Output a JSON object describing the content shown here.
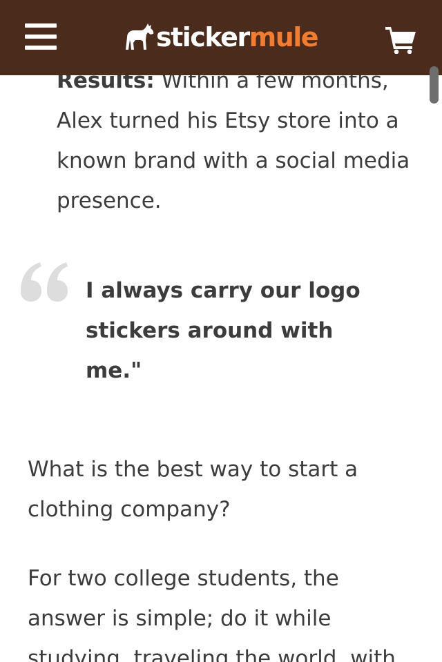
{
  "header": {
    "logo_word1": "sticker",
    "logo_word2": "mule",
    "colors": {
      "background": "#4a2b1c",
      "logo_primary": "#ffffff",
      "logo_accent": "#f27d32"
    },
    "icons": {
      "menu": "hamburger-menu-icon",
      "logo": "mule-icon",
      "cart": "shopping-cart-icon"
    }
  },
  "article": {
    "bullet": {
      "lead": "Results:",
      "text": " Within a few months, Alex turned his Etsy store into a known brand with a social media presence."
    },
    "quote": {
      "text": "I always carry our logo stickers around with me.\""
    },
    "paragraphs": [
      "What is the best way to start a clothing company?",
      "For two college students, the answer is simple; do it while studying, traveling the world, with"
    ]
  }
}
